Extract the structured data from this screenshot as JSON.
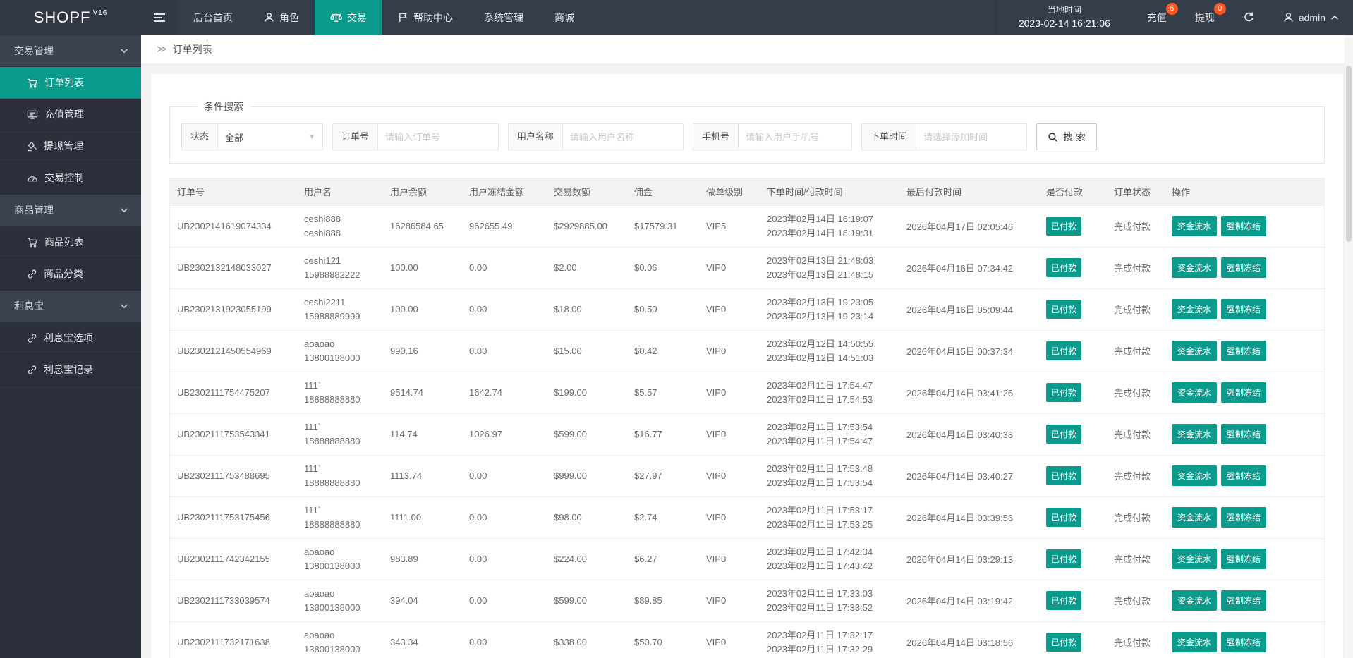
{
  "brand": {
    "name": "SHOPF",
    "version": "V16"
  },
  "colors": {
    "accent": "#0b9b8c",
    "badge": "#ff5722",
    "header_bg": "#363d4a",
    "sidebar_bg": "#2b303c"
  },
  "topbar": {
    "nav": [
      {
        "label": "后台首页",
        "icon": "",
        "active": false
      },
      {
        "label": "角色",
        "icon": "user",
        "active": false
      },
      {
        "label": "交易",
        "icon": "scales",
        "active": true
      },
      {
        "label": "帮助中心",
        "icon": "flag",
        "active": false
      },
      {
        "label": "系统管理",
        "icon": "",
        "active": false
      },
      {
        "label": "商城",
        "icon": "",
        "active": false
      }
    ],
    "local_time_label": "当地时间",
    "local_time_value": "2023-02-14 16:21:06",
    "recharge_label": "充值",
    "recharge_badge": "6",
    "withdraw_label": "提现",
    "withdraw_badge": "0",
    "admin_label": "admin"
  },
  "sidebar": {
    "items": [
      {
        "type": "group",
        "label": "交易管理"
      },
      {
        "type": "item",
        "label": "订单列表",
        "icon": "cart",
        "active": true
      },
      {
        "type": "item",
        "label": "充值管理",
        "icon": "board",
        "active": false
      },
      {
        "type": "item",
        "label": "提现管理",
        "icon": "gavel",
        "active": false
      },
      {
        "type": "item",
        "label": "交易控制",
        "icon": "gauge",
        "active": false
      },
      {
        "type": "group",
        "label": "商品管理"
      },
      {
        "type": "item",
        "label": "商品列表",
        "icon": "cart",
        "active": false
      },
      {
        "type": "item",
        "label": "商品分类",
        "icon": "link",
        "active": false
      },
      {
        "type": "group",
        "label": "利息宝"
      },
      {
        "type": "item",
        "label": "利息宝选项",
        "icon": "link",
        "active": false
      },
      {
        "type": "item",
        "label": "利息宝记录",
        "icon": "link",
        "active": false
      }
    ]
  },
  "breadcrumb": {
    "icon": "≫",
    "title": "订单列表"
  },
  "search": {
    "legend": "条件搜索",
    "status_label": "状态",
    "status_value": "全部",
    "order_label": "订单号",
    "order_placeholder": "请输入订单号",
    "username_label": "用户名称",
    "username_placeholder": "请输入用户名称",
    "phone_label": "手机号",
    "phone_placeholder": "请输入用户手机号",
    "time_label": "下单时间",
    "time_placeholder": "请选择添加时间",
    "search_button": "搜 索"
  },
  "table": {
    "columns": [
      "订单号",
      "用户名",
      "用户余额",
      "用户冻结金额",
      "交易数额",
      "佣金",
      "做单级别",
      "下单时间/付款时间",
      "最后付款时间",
      "是否付款",
      "订单状态",
      "操作"
    ],
    "paid_label": "已付款",
    "status_label": "完成付款",
    "action_labels": [
      "资金流水",
      "强制冻结"
    ],
    "rows": [
      {
        "id": "UB2302141619074334",
        "user1": "ceshi888",
        "user2": "ceshi888",
        "balance": "16286584.65",
        "frozen": "962655.49",
        "amount": "$2929885.00",
        "commission": "$17579.31",
        "level": "VIP5",
        "time1": "2023年02月14日 16:19:07",
        "time2": "2023年02月14日 16:19:31",
        "last_pay": "2026年04月17日 02:05:46"
      },
      {
        "id": "UB2302132148033027",
        "user1": "ceshi121",
        "user2": "15988882222",
        "balance": "100.00",
        "frozen": "0.00",
        "amount": "$2.00",
        "commission": "$0.06",
        "level": "VIP0",
        "time1": "2023年02月13日 21:48:03",
        "time2": "2023年02月13日 21:48:15",
        "last_pay": "2026年04月16日 07:34:42"
      },
      {
        "id": "UB2302131923055199",
        "user1": "ceshi2211",
        "user2": "15988889999",
        "balance": "100.00",
        "frozen": "0.00",
        "amount": "$18.00",
        "commission": "$0.50",
        "level": "VIP0",
        "time1": "2023年02月13日 19:23:05",
        "time2": "2023年02月13日 19:23:14",
        "last_pay": "2026年04月16日 05:09:44"
      },
      {
        "id": "UB2302121450554969",
        "user1": "aoaoao",
        "user2": "13800138000",
        "balance": "990.16",
        "frozen": "0.00",
        "amount": "$15.00",
        "commission": "$0.42",
        "level": "VIP0",
        "time1": "2023年02月12日 14:50:55",
        "time2": "2023年02月12日 14:51:03",
        "last_pay": "2026年04月15日 00:37:34"
      },
      {
        "id": "UB2302111754475207",
        "user1": "111`",
        "user2": "18888888880",
        "balance": "9514.74",
        "frozen": "1642.74",
        "amount": "$199.00",
        "commission": "$5.57",
        "level": "VIP0",
        "time1": "2023年02月11日 17:54:47",
        "time2": "2023年02月11日 17:54:53",
        "last_pay": "2026年04月14日 03:41:26"
      },
      {
        "id": "UB2302111753543341",
        "user1": "111`",
        "user2": "18888888880",
        "balance": "114.74",
        "frozen": "1026.97",
        "amount": "$599.00",
        "commission": "$16.77",
        "level": "VIP0",
        "time1": "2023年02月11日 17:53:54",
        "time2": "2023年02月11日 17:54:47",
        "last_pay": "2026年04月14日 03:40:33"
      },
      {
        "id": "UB2302111753488695",
        "user1": "111`",
        "user2": "18888888880",
        "balance": "1113.74",
        "frozen": "0.00",
        "amount": "$999.00",
        "commission": "$27.97",
        "level": "VIP0",
        "time1": "2023年02月11日 17:53:48",
        "time2": "2023年02月11日 17:53:54",
        "last_pay": "2026年04月14日 03:40:27"
      },
      {
        "id": "UB2302111753175456",
        "user1": "111`",
        "user2": "18888888880",
        "balance": "1111.00",
        "frozen": "0.00",
        "amount": "$98.00",
        "commission": "$2.74",
        "level": "VIP0",
        "time1": "2023年02月11日 17:53:17",
        "time2": "2023年02月11日 17:53:25",
        "last_pay": "2026年04月14日 03:39:56"
      },
      {
        "id": "UB2302111742342155",
        "user1": "aoaoao",
        "user2": "13800138000",
        "balance": "983.89",
        "frozen": "0.00",
        "amount": "$224.00",
        "commission": "$6.27",
        "level": "VIP0",
        "time1": "2023年02月11日 17:42:34",
        "time2": "2023年02月11日 17:43:42",
        "last_pay": "2026年04月14日 03:29:13"
      },
      {
        "id": "UB2302111733039574",
        "user1": "aoaoao",
        "user2": "13800138000",
        "balance": "394.04",
        "frozen": "0.00",
        "amount": "$599.00",
        "commission": "$89.85",
        "level": "VIP0",
        "time1": "2023年02月11日 17:33:03",
        "time2": "2023年02月11日 17:33:52",
        "last_pay": "2026年04月14日 03:19:42"
      },
      {
        "id": "UB2302111732171638",
        "user1": "aoaoao",
        "user2": "13800138000",
        "balance": "343.34",
        "frozen": "0.00",
        "amount": "$338.00",
        "commission": "$50.70",
        "level": "VIP0",
        "time1": "2023年02月11日 17:32:17",
        "time2": "2023年02月11日 17:32:29",
        "last_pay": "2026年04月14日 03:18:56"
      }
    ]
  }
}
